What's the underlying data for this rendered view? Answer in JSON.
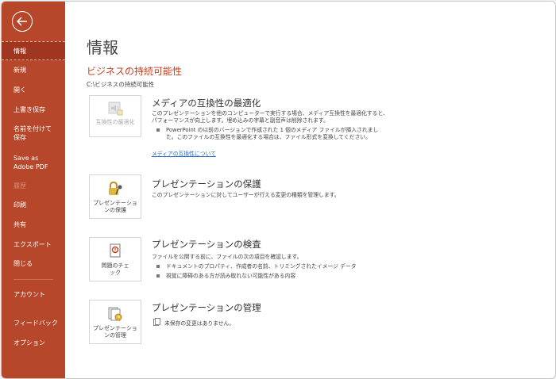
{
  "sidebar": {
    "items": [
      {
        "label": "情報"
      },
      {
        "label": "新規"
      },
      {
        "label": "開く"
      },
      {
        "label": "上書き保存"
      },
      {
        "label": "名前を付けて保存"
      },
      {
        "label": "Save as Adobe PDF"
      },
      {
        "label": "履歴"
      },
      {
        "label": "印刷"
      },
      {
        "label": "共有"
      },
      {
        "label": "エクスポート"
      },
      {
        "label": "閉じる"
      },
      {
        "label": "アカウント"
      },
      {
        "label": "フィードバック"
      },
      {
        "label": "オプション"
      }
    ]
  },
  "main": {
    "title": "情報",
    "doc_name": "ビジネスの持続可能性",
    "doc_path": "C:\\ビジネスの持続可能性",
    "sections": [
      {
        "tile_label": "互換性の最適化",
        "heading": "メディアの互換性の最適化",
        "desc": "このプレゼンテーションを他のコンピューターで実行する場合、メディア互換性を最適化すると、パフォーマンスが向上します。埋め込みの字幕と副音声は削除されます。",
        "bullet": "PowerPoint の以前のバージョンで作成された 1 個のメディア ファイルが挿入されました。このファイルの互換性を最適化する場合は、ファイル形式を変換してください。",
        "link": "メディアの互換性について"
      },
      {
        "tile_label": "プレゼンテーションの保護",
        "heading": "プレゼンテーションの保護",
        "desc": "このプレゼンテーションに対してユーザーが行える変更の種類を管理します。"
      },
      {
        "tile_label": "問題のチェック",
        "heading": "プレゼンテーションの検査",
        "desc": "ファイルを公開する前に、ファイルの次の項目を確認します。",
        "bullets": [
          "ドキュメントのプロパティ、作成者の名前、トリミングされたイメージ データ",
          "視覚に障碍のある方が読み取れない可能性がある内容"
        ]
      },
      {
        "tile_label": "プレゼンテーションの管理",
        "heading": "プレゼンテーションの管理",
        "note": "未保存の変更はありません。"
      }
    ]
  },
  "icons": {
    "back": "back-arrow-icon",
    "media": "media-speaker-icon",
    "protect": "lock-key-icon",
    "inspect": "inspect-document-icon",
    "manage": "manage-versions-icon"
  },
  "colors": {
    "accent": "#b7472a",
    "accent_dark": "#a0361f",
    "title_red": "#c43e1c",
    "link": "#2a6ebb"
  }
}
